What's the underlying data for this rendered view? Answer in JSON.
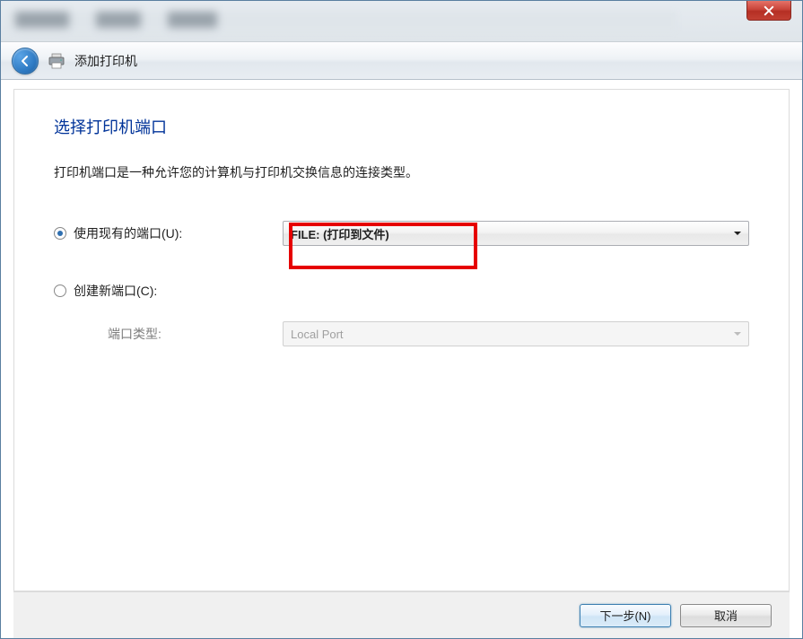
{
  "titlebar": {
    "close_label": "Close"
  },
  "header": {
    "title": "添加打印机"
  },
  "page": {
    "heading": "选择打印机端口",
    "description": "打印机端口是一种允许您的计算机与打印机交换信息的连接类型。"
  },
  "options": {
    "use_existing": {
      "label": "使用现有的端口(U):",
      "selected": "FILE: (打印到文件)"
    },
    "create_new": {
      "label": "创建新端口(C):",
      "sub_label": "端口类型:",
      "selected": "Local Port"
    }
  },
  "footer": {
    "next": "下一步(N)",
    "cancel": "取消"
  }
}
